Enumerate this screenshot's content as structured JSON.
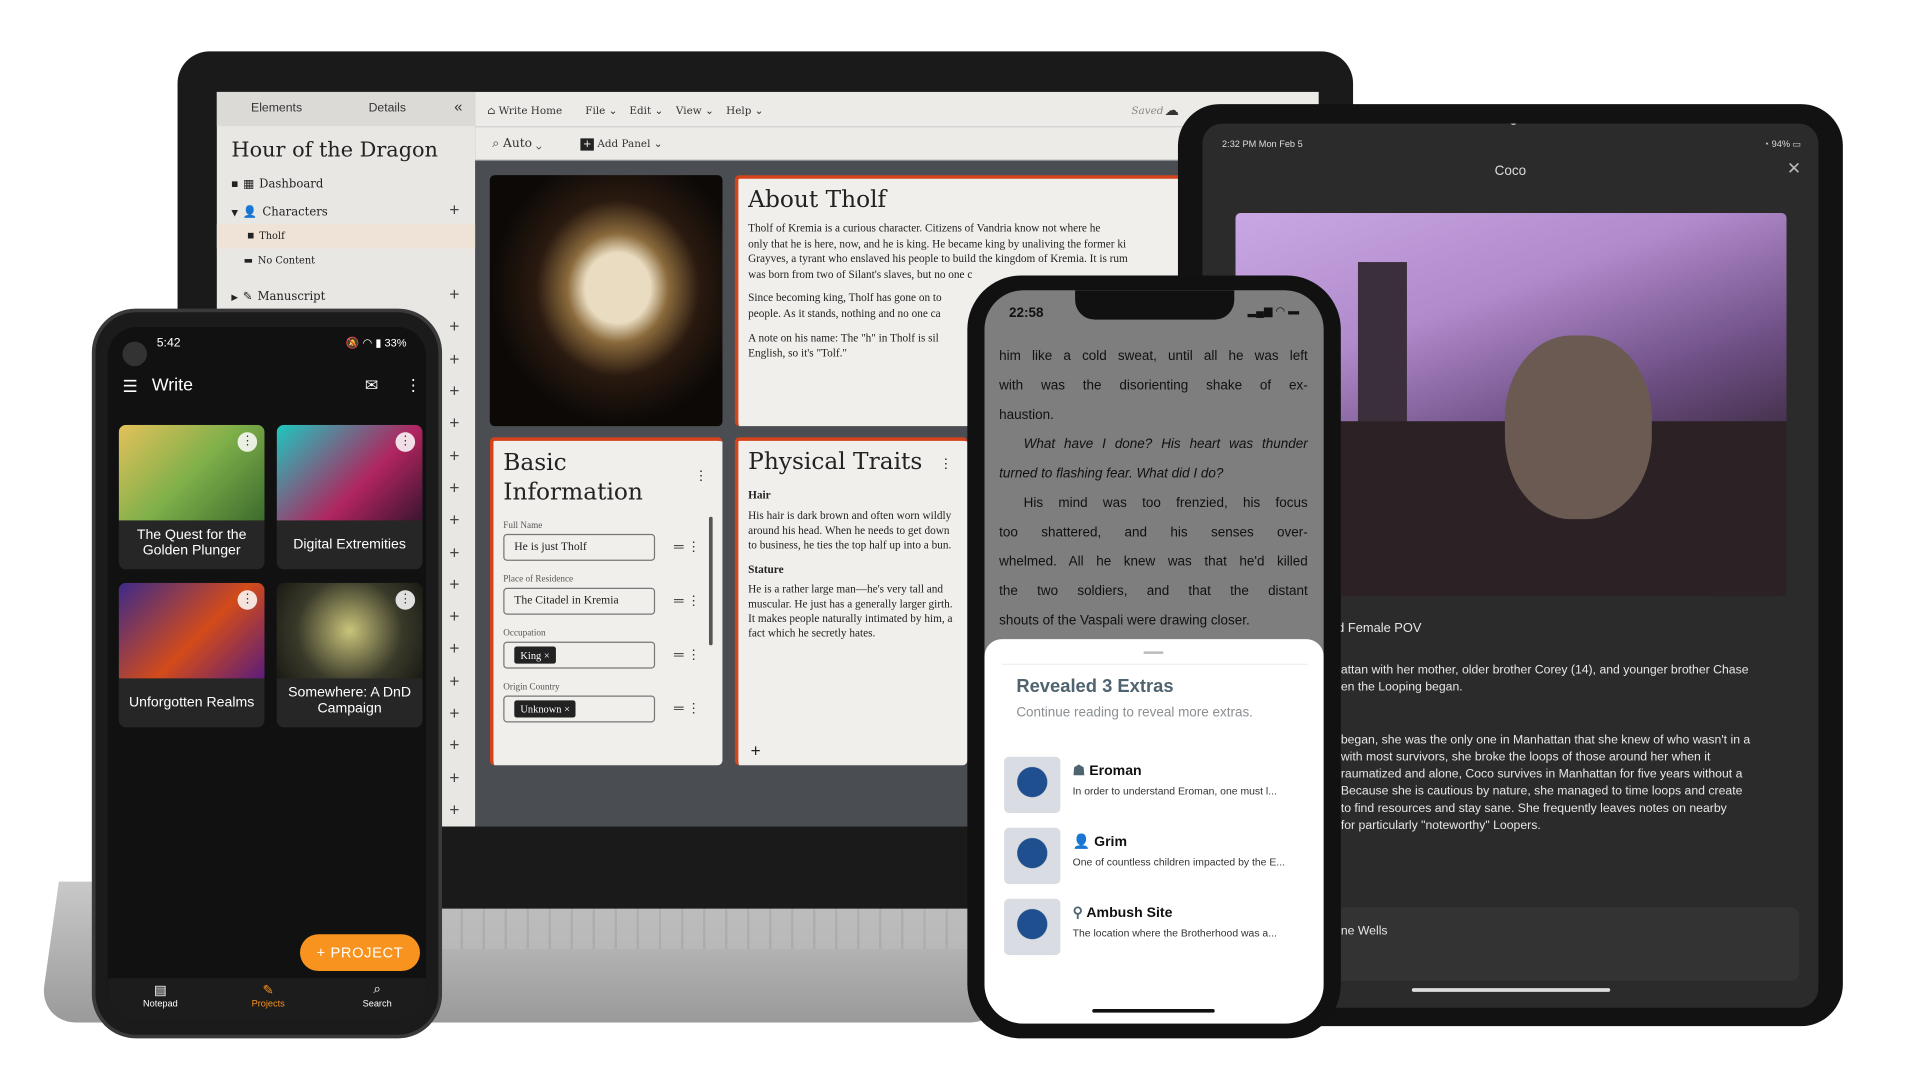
{
  "laptop": {
    "sidebar": {
      "tabs": [
        "Elements",
        "Details"
      ],
      "collapse_icon": "double-chevron-left",
      "project_title": "Hour of the Dragon",
      "items": [
        {
          "label": "Dashboard",
          "icon": "grid-icon"
        },
        {
          "label": "Characters",
          "icon": "person-icon"
        },
        {
          "label": "Tholf",
          "icon": "page-icon"
        },
        {
          "label": "No Content",
          "icon": "folder-icon"
        },
        {
          "label": "Manuscript",
          "icon": "pencil-icon"
        }
      ]
    },
    "toolbar": {
      "home": "Write Home",
      "menus": [
        "File",
        "Edit",
        "View",
        "Help"
      ],
      "saved": "Saved",
      "zoom": "Auto",
      "add_panel": "Add Panel"
    },
    "about": {
      "title": "About Tholf",
      "paragraphs": [
        "Tholf of Kremia is a curious character. Citizens of Vandria know not where he",
        "only that he is here, now, and he is king. He became king by unaliving the former ki",
        "Grayves, a tyrant who enslaved his people to build the kingdom of Kremia. It is rum",
        "was born from two of Silant's slaves, but no one c",
        "Since becoming king, Tholf has gone on to",
        "people. As it stands, nothing and no one ca",
        "A note on his name: The \"h\" in Tholf is sil",
        "English, so it's \"Tolf.\""
      ]
    },
    "basic_info": {
      "title": "Basic Information",
      "fields": [
        {
          "label": "Full Name",
          "value": "He is just Tholf"
        },
        {
          "label": "Place of Residence",
          "value": "The Citadel in Kremia"
        },
        {
          "label": "Occupation",
          "chip": "King"
        },
        {
          "label": "Origin Country",
          "chip": "Unknown"
        }
      ]
    },
    "physical": {
      "title": "Physical Traits",
      "sections": [
        {
          "heading": "Hair",
          "text": "His hair is dark brown and often worn wildly around his head. When he needs to get down to business, he ties the top half up into a bun."
        },
        {
          "heading": "Stature",
          "text": "He is a rather large man—he's very tall and muscular. He just has a generally larger girth. It makes people naturally intimated by him, a fact which he secretly hates."
        }
      ]
    }
  },
  "tablet": {
    "time": "2:32 PM  Mon Feb 5",
    "battery": "94%",
    "title": "Coco",
    "subtitle": "d Female POV",
    "para1": [
      "attan with her mother, older brother Corey (14), and younger brother Chase",
      "en the Looping began."
    ],
    "para2": [
      "began, she was the only one in Manhattan that she knew of who wasn't in a",
      " with most survivors, she broke the loops of those around her when it",
      "raumatized and alone, Coco survives in Manhattan for five years without a",
      "Because she is cautious by nature, she managed to time loops and create",
      " to find resources and stay sane. She frequently leaves notes on nearby",
      " for particularly \"noteworthy\" Loopers."
    ],
    "footer": "ne Wells"
  },
  "iphone": {
    "time": "22:58",
    "reading": [
      "him like a cold sweat, until all he was left",
      "with was the disorienting shake of ex-",
      "haustion.",
      "What have I done? His heart was thunder",
      "turned to flashing fear. What did I do?",
      "His mind was too frenzied, his focus",
      "too shattered, and his senses over-",
      "whelmed. All he knew was that he'd killed",
      "the two soldiers, and that the distant",
      "shouts of the Vaspali were drawing closer."
    ],
    "sheet": {
      "title": "Revealed 3 Extras",
      "subtitle": "Continue reading to reveal more extras.",
      "extras": [
        {
          "icon": "mask-icon",
          "name": "Eroman",
          "desc": "In order to understand Eroman, one must l..."
        },
        {
          "icon": "person-icon",
          "name": "Grim",
          "desc": "One of countless children impacted by the E..."
        },
        {
          "icon": "location-pin-icon",
          "name": "Ambush Site",
          "desc": "The location where the Brotherhood was a..."
        }
      ]
    }
  },
  "android": {
    "time": "5:42",
    "status": "33%",
    "title": "Write",
    "projects": [
      "The Quest for the Golden Plunger",
      "Digital Extremities",
      "Unforgotten Realms",
      "Somewhere: A DnD Campaign"
    ],
    "fab": "+ PROJECT",
    "nav": [
      "Notepad",
      "Projects",
      "Search"
    ],
    "accent": "#f7931e"
  },
  "colors": {
    "panel_accent": "#d4431c",
    "sheet_title": "#4f6470"
  }
}
